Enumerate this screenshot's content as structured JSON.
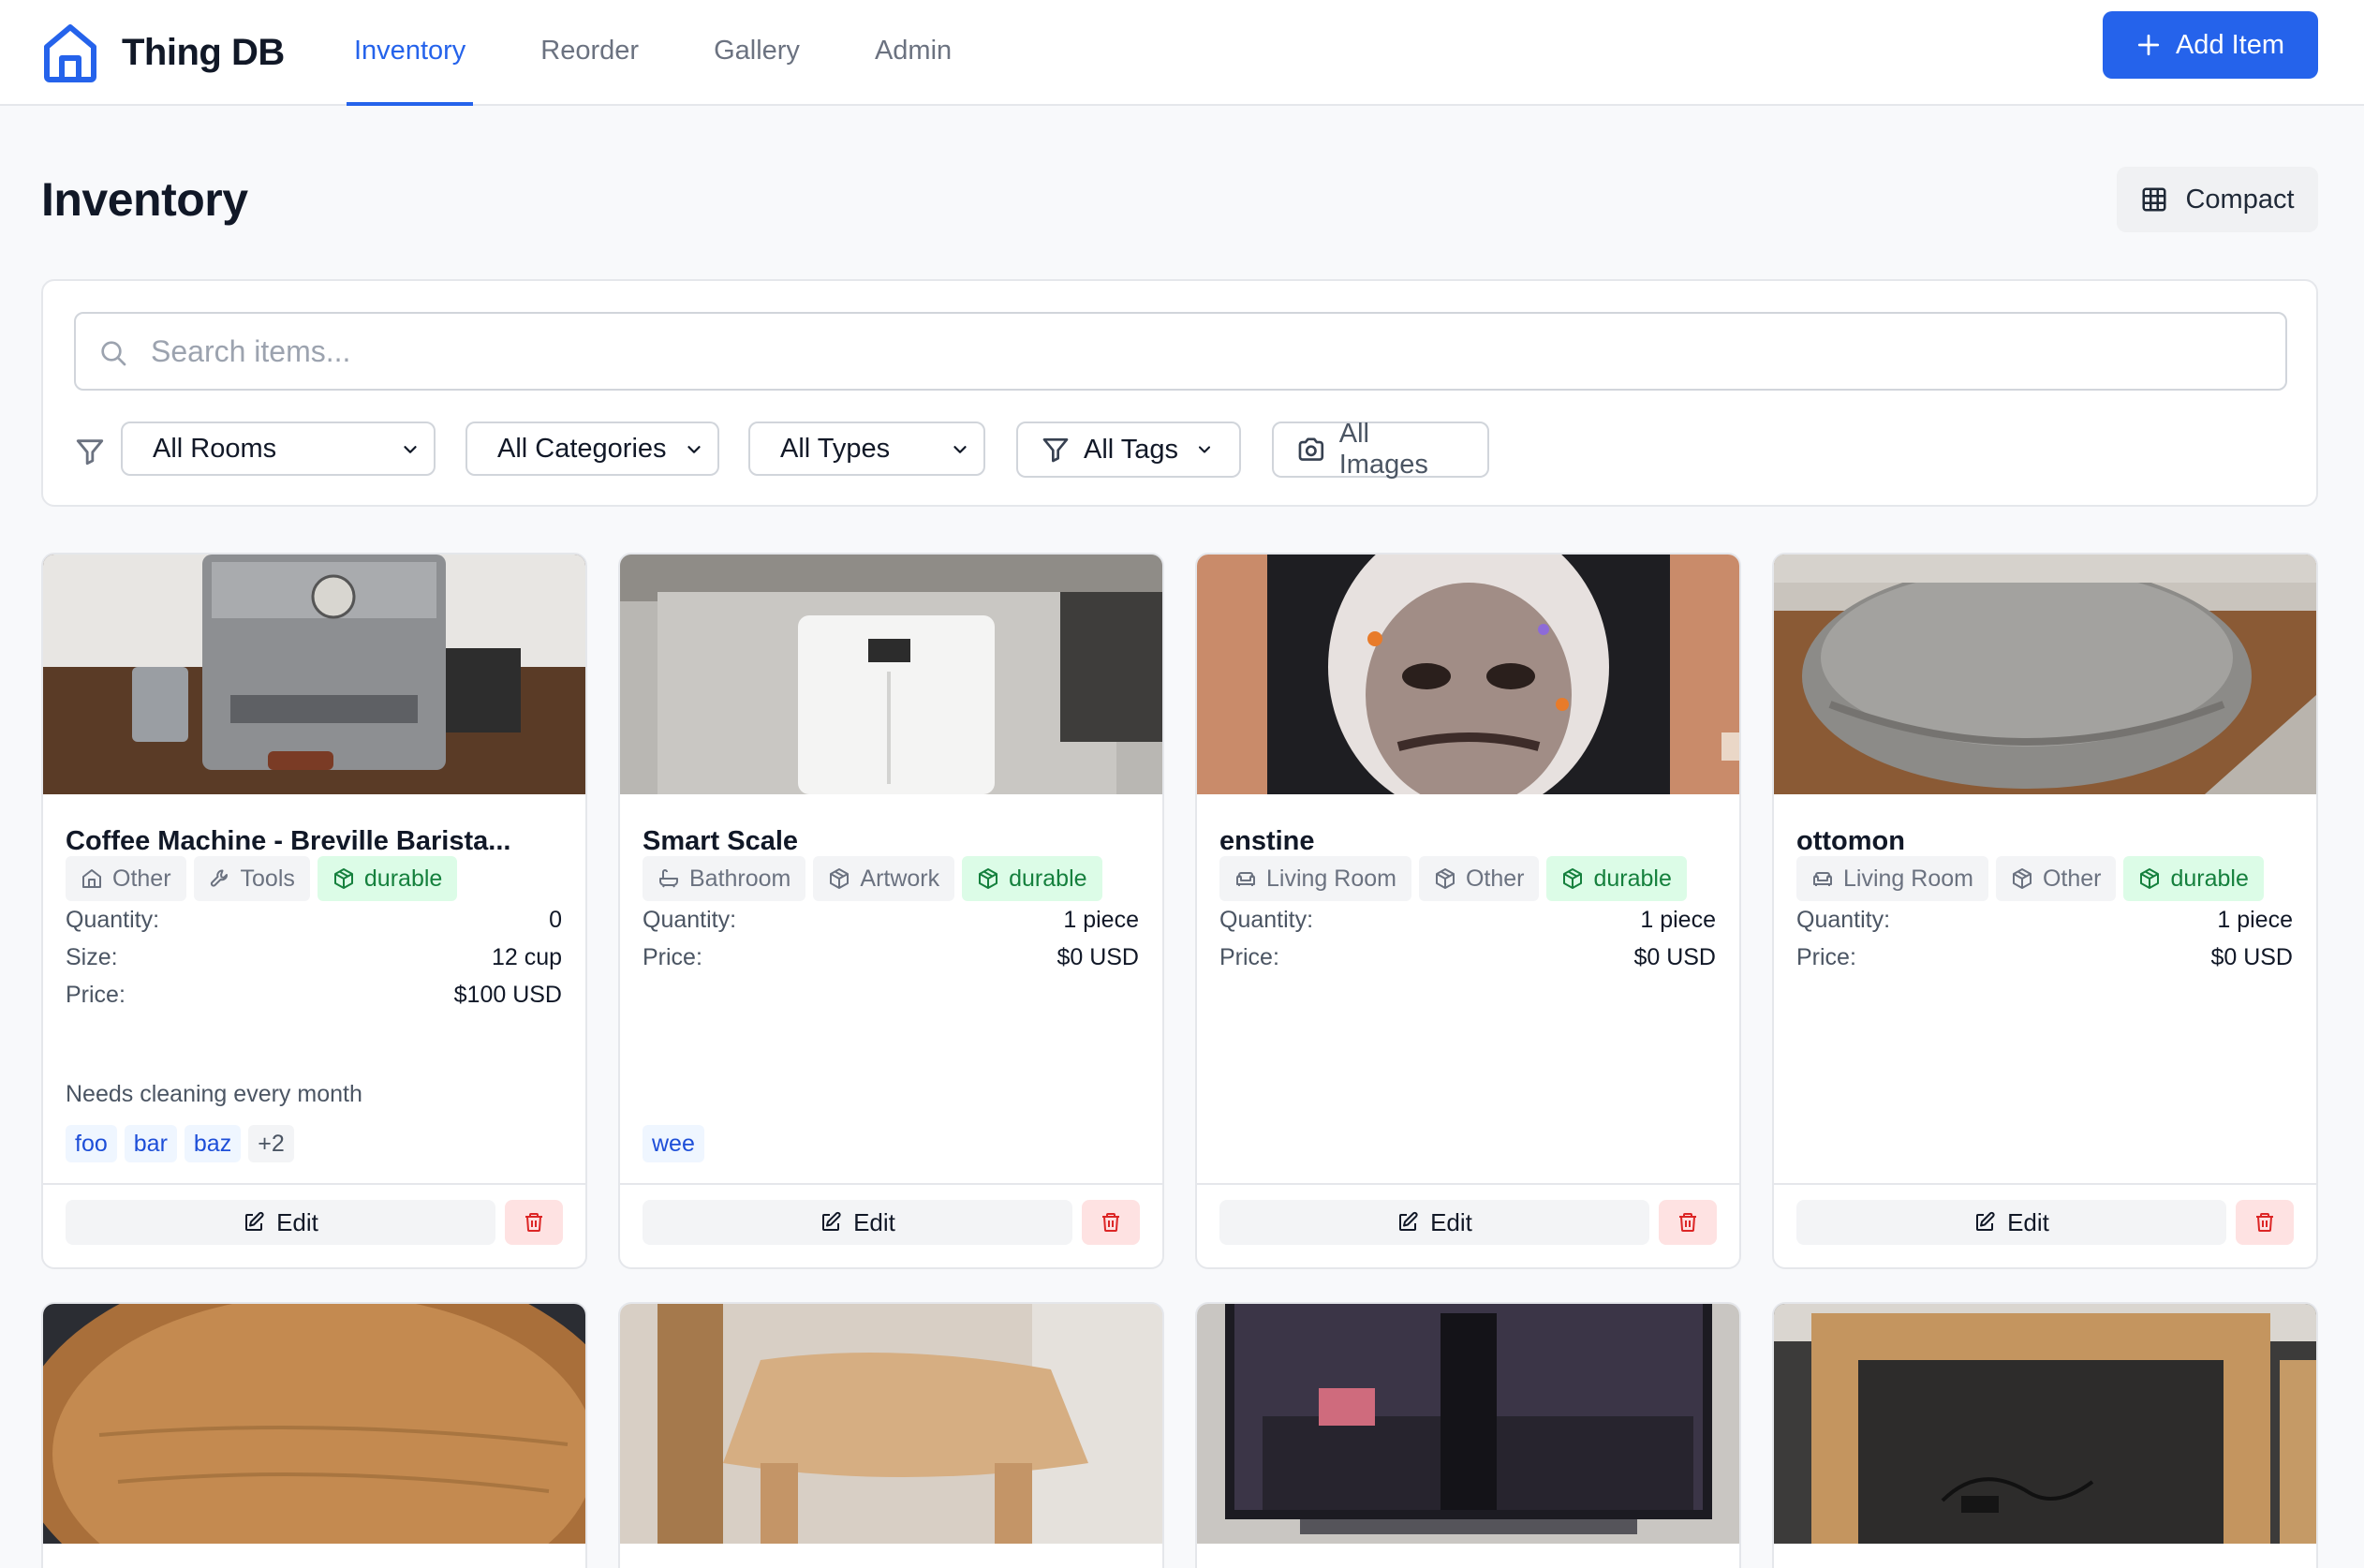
{
  "app": {
    "name": "Thing DB"
  },
  "nav": {
    "items": [
      "Inventory",
      "Reorder",
      "Gallery",
      "Admin"
    ],
    "active": "Inventory"
  },
  "actions": {
    "add_item": "Add Item",
    "compact": "Compact"
  },
  "page": {
    "title": "Inventory"
  },
  "filters": {
    "search_placeholder": "Search items...",
    "rooms": "All Rooms",
    "categories": "All Categories",
    "types": "All Types",
    "tags": "All Tags",
    "images": "All Images"
  },
  "labels": {
    "quantity": "Quantity:",
    "size": "Size:",
    "price": "Price:",
    "edit": "Edit"
  },
  "items": [
    {
      "title": "Coffee Machine - Breville Barista...",
      "badges": [
        {
          "label": "Other",
          "icon": "home-icon"
        },
        {
          "label": "Tools",
          "icon": "wrench-icon"
        },
        {
          "label": "durable",
          "icon": "package-icon",
          "style": "green"
        }
      ],
      "quantity": "0",
      "size": "12 cup",
      "price": "$100 USD",
      "notes": "Needs cleaning every month",
      "tags": [
        "foo",
        "bar",
        "baz"
      ],
      "more_tags": "+2"
    },
    {
      "title": "Smart Scale",
      "badges": [
        {
          "label": "Bathroom",
          "icon": "bath-icon"
        },
        {
          "label": "Artwork",
          "icon": "package-icon"
        },
        {
          "label": "durable",
          "icon": "package-icon",
          "style": "green"
        }
      ],
      "quantity": "1 piece",
      "price": "$0 USD",
      "tags": [
        "wee"
      ]
    },
    {
      "title": "enstine",
      "badges": [
        {
          "label": "Living Room",
          "icon": "sofa-icon"
        },
        {
          "label": "Other",
          "icon": "package-icon"
        },
        {
          "label": "durable",
          "icon": "package-icon",
          "style": "green"
        }
      ],
      "quantity": "1 piece",
      "price": "$0 USD"
    },
    {
      "title": "ottomon",
      "badges": [
        {
          "label": "Living Room",
          "icon": "sofa-icon"
        },
        {
          "label": "Other",
          "icon": "package-icon"
        },
        {
          "label": "durable",
          "icon": "package-icon",
          "style": "green"
        }
      ],
      "quantity": "1 piece",
      "price": "$0 USD"
    }
  ],
  "colors": {
    "accent": "#2563eb",
    "durable_bg": "#dcfce7",
    "durable_text": "#15803d",
    "delete_bg": "#fee2e2",
    "delete_icon": "#dc2626",
    "tag_text": "#1d4ed8"
  }
}
